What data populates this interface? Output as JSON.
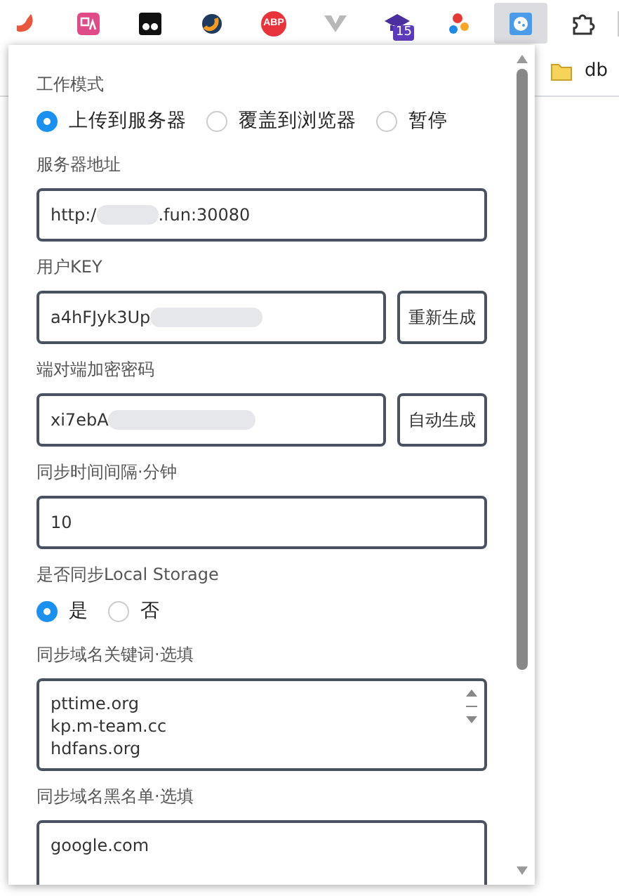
{
  "toolbar": {
    "extensions": [
      {
        "kind": "snake"
      },
      {
        "kind": "translate"
      },
      {
        "kind": "eyes"
      },
      {
        "kind": "swirl"
      },
      {
        "kind": "abp",
        "text": "ABP"
      },
      {
        "kind": "vee"
      },
      {
        "kind": "cap",
        "badge": "15"
      },
      {
        "kind": "balls"
      },
      {
        "kind": "cookie",
        "selected": true
      },
      {
        "kind": "puzzle",
        "selected": false
      }
    ]
  },
  "bookmarks": [
    {
      "label": "db"
    }
  ],
  "popup": {
    "work_mode": {
      "label": "工作模式",
      "options": [
        {
          "label": "上传到服务器",
          "selected": true
        },
        {
          "label": "覆盖到浏览器",
          "selected": false
        },
        {
          "label": "暂停",
          "selected": false
        }
      ]
    },
    "server": {
      "label": "服务器地址",
      "value": "http:/",
      "value_after_redaction": ".fun:30080"
    },
    "user_key": {
      "label": "用户KEY",
      "value": "a4hFJyk3Up",
      "button": "重新生成"
    },
    "password": {
      "label": "端对端加密密码",
      "value": "xi7ebA",
      "button": "自动生成"
    },
    "interval": {
      "label": "同步时间间隔·分钟",
      "value": "10"
    },
    "local_storage": {
      "label": "是否同步Local Storage",
      "options": [
        {
          "label": "是",
          "selected": true
        },
        {
          "label": "否",
          "selected": false
        }
      ]
    },
    "keywords": {
      "label": "同步域名关键词·选填",
      "lines": [
        "pttime.org",
        "kp.m-team.cc",
        "hdfans.org"
      ]
    },
    "blacklist": {
      "label": "同步域名黑名单·选填",
      "lines": [
        "google.com"
      ]
    }
  }
}
